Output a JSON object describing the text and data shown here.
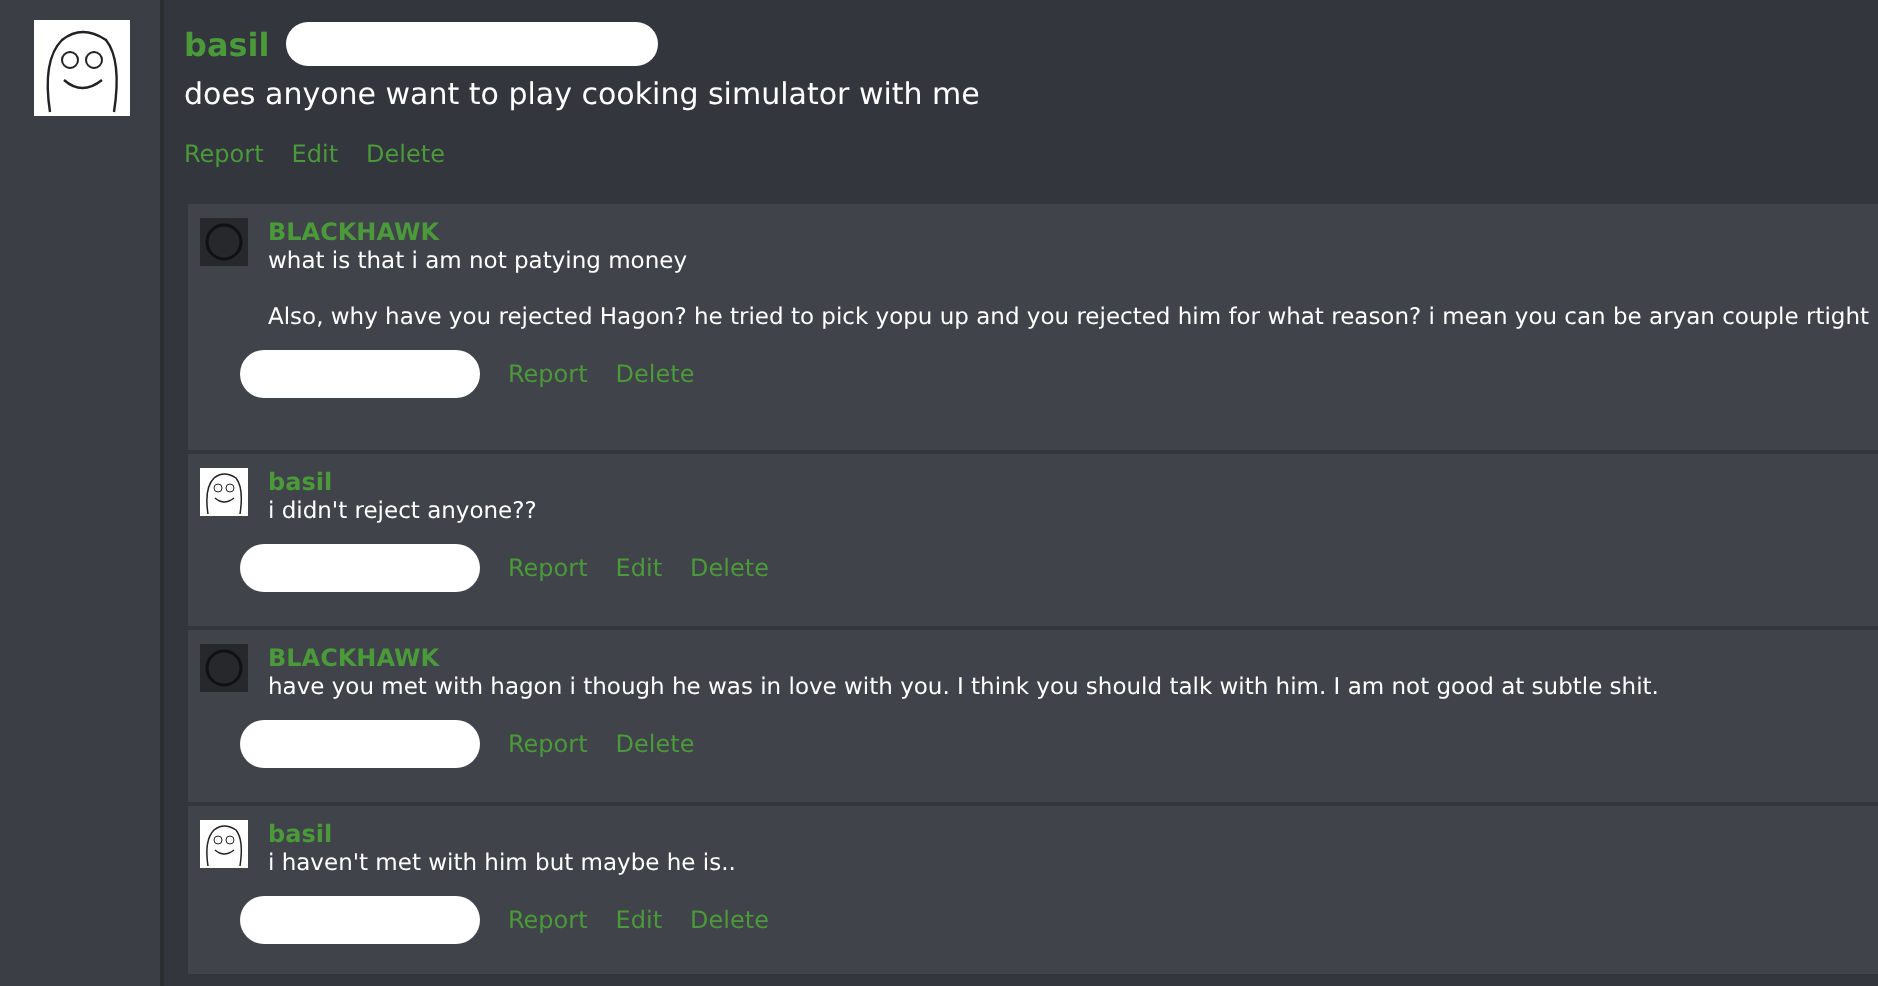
{
  "post": {
    "author": "basil",
    "avatar": {
      "kind": "face"
    },
    "message": "does anyone want to play cooking simulator with me",
    "actions": [
      "Report",
      "Edit",
      "Delete"
    ]
  },
  "replies": [
    {
      "author": "BLACKHAWK",
      "avatar": {
        "kind": "circle"
      },
      "paragraphs": [
        "what is that i am not patying money",
        "Also, why have you rejected Hagon? he tried to pick yopu up and you rejected him for what reason? i mean you can be aryan couple rtight"
      ],
      "actions": [
        "Report",
        "Delete"
      ]
    },
    {
      "author": "basil",
      "avatar": {
        "kind": "face"
      },
      "paragraphs": [
        "i didn't reject anyone??"
      ],
      "actions": [
        "Report",
        "Edit",
        "Delete"
      ]
    },
    {
      "author": "BLACKHAWK",
      "avatar": {
        "kind": "circle"
      },
      "paragraphs": [
        "have you met with hagon i though he was in love with you. I think you should talk with him. I am not good at subtle shit."
      ],
      "actions": [
        "Report",
        "Delete"
      ]
    },
    {
      "author": "basil",
      "avatar": {
        "kind": "face"
      },
      "paragraphs": [
        "i haven't met with him but maybe he is.."
      ],
      "actions": [
        "Report",
        "Edit",
        "Delete"
      ]
    }
  ]
}
